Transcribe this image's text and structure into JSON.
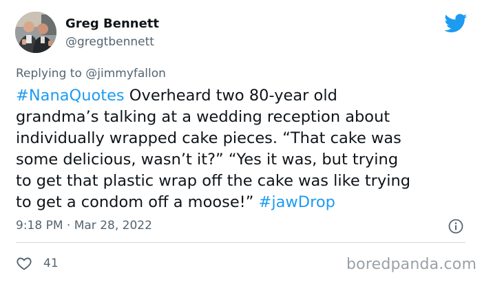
{
  "author": {
    "display_name": "Greg Bennett",
    "handle": "@gregtbennett",
    "avatar_icon": "profile-photo"
  },
  "brand": {
    "logo_icon": "twitter-bird-icon",
    "accent_color": "#1d9bf0"
  },
  "reply": {
    "prefix": "Replying to",
    "mention": "@jimmyfallon"
  },
  "tweet": {
    "lines": [
      {
        "hashtag": "#NanaQuotes",
        "text": " Overheard two 80-year old"
      },
      {
        "text": "grandma’s talking at a wedding reception about"
      },
      {
        "text": "individually wrapped cake pieces. “That cake was"
      },
      {
        "text": "some delicious, wasn’t it?” “Yes it was, but trying"
      },
      {
        "text": "to get that plastic wrap off the cake was like trying"
      },
      {
        "text": "to get a condom off a moose!” ",
        "hashtag": "#jawDrop"
      }
    ]
  },
  "meta": {
    "time": "9:18 PM",
    "separator": " · ",
    "date": "Mar 28, 2022",
    "info_icon": "info-icon"
  },
  "engagement": {
    "likes": "41",
    "like_icon": "heart-icon"
  },
  "watermark": {
    "text": "boredpanda.com"
  }
}
